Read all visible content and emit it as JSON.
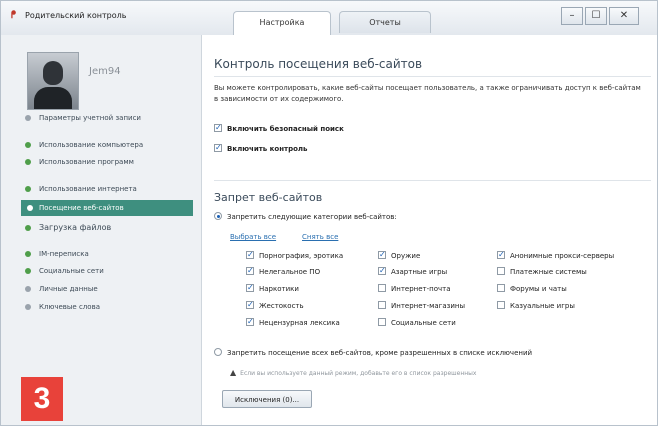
{
  "window": {
    "title": "Родительский контроль",
    "tabs": [
      "Настройка",
      "Отчеты"
    ],
    "controls": {
      "minimize": "–",
      "maximize": "☐",
      "close": "✕"
    }
  },
  "sidebar": {
    "username": "Jem94",
    "items": [
      {
        "label": "Параметры учетной записи",
        "icon": "gray-dot"
      },
      {
        "label": "Использование компьютера",
        "icon": "green-dot"
      },
      {
        "label": "Использование программ",
        "icon": "green-dot"
      },
      {
        "label": "Использование интернета",
        "icon": "green-dot"
      },
      {
        "label": "Посещение веб-сайтов",
        "icon": "white-dot",
        "selected": true
      },
      {
        "label": "Загрузка файлов",
        "icon": "green-dot"
      },
      {
        "label": "IM-переписка",
        "icon": "green-dot"
      },
      {
        "label": "Социальные сети",
        "icon": "green-dot"
      },
      {
        "label": "Личные данные",
        "icon": "gray-dot"
      },
      {
        "label": "Ключевые слова",
        "icon": "gray-dot"
      }
    ]
  },
  "main": {
    "title": "Контроль посещения веб-сайтов",
    "description": "Вы можете контролировать, какие веб-сайты посещает пользователь, а также ограничивать доступ к веб-сайтам в зависимости от их содержимого.",
    "safe_search": {
      "label": "Включить безопасный поиск",
      "checked": true
    },
    "enable_control": {
      "label": "Включить контроль",
      "checked": true
    },
    "block_section_title": "Запрет веб-сайтов",
    "block_categories_radio": {
      "label": "Запретить следующие категории веб-сайтов:",
      "selected": true
    },
    "select_all": "Выбрать все",
    "clear_all": "Снять все",
    "categories": [
      [
        {
          "label": "Порнография, эротика",
          "checked": true
        },
        {
          "label": "Нелегальное ПО",
          "checked": true
        },
        {
          "label": "Наркотики",
          "checked": true
        },
        {
          "label": "Жестокость",
          "checked": true
        },
        {
          "label": "Нецензурная лексика",
          "checked": true
        }
      ],
      [
        {
          "label": "Оружие",
          "checked": true
        },
        {
          "label": "Азартные игры",
          "checked": true
        },
        {
          "label": "Интернет-почта",
          "checked": false
        },
        {
          "label": "Интернет-магазины",
          "checked": false
        },
        {
          "label": "Социальные сети",
          "checked": false
        }
      ],
      [
        {
          "label": "Анонимные прокси-серверы",
          "checked": true
        },
        {
          "label": "Платежные системы",
          "checked": false
        },
        {
          "label": "Форумы и чаты",
          "checked": false
        },
        {
          "label": "Казуальные игры",
          "checked": false
        }
      ]
    ],
    "block_all_radio": {
      "label": "Запретить посещение всех веб-сайтов, кроме разрешенных в списке исключений",
      "selected": false
    },
    "warning": "Если вы используете данный режим, добавьте его в список разрешенных",
    "exceptions_button": "Исключения (0)..."
  },
  "badge": "3"
}
